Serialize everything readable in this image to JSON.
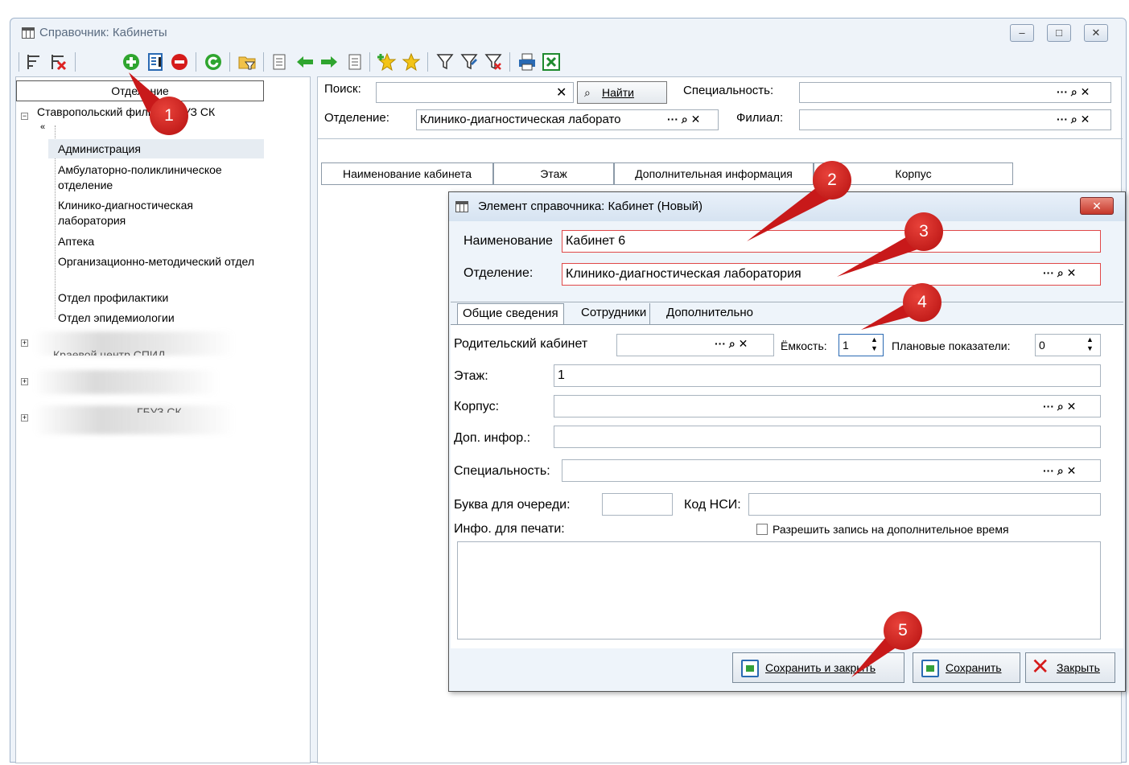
{
  "window": {
    "title": "Справочник: Кабинеты",
    "controls": [
      "‒",
      "□",
      "✕"
    ]
  },
  "left": {
    "header": "Отделение",
    "root": "Ставропольский филиал ГБУЗ СК",
    "root_sub": "«",
    "children": [
      "Администрация",
      "Амбулаторно-поликлиническое отделение",
      "Клинико-диагностическая лаборатория",
      "Аптека",
      "Организационно-методический отдел",
      "Отдел профилактики",
      "Отдел эпидемиологии"
    ],
    "blurred_1": "Краевой центр СПИД",
    "blurred_2": "ГБУЗ СК"
  },
  "filters": {
    "search_label": "Поиск:",
    "find_button": "Найти",
    "specialty_label": "Специальность:",
    "department_label": "Отделение:",
    "department_value": "Клинико-диагностическая лаборато",
    "branch_label": "Филиал:"
  },
  "table": {
    "columns": [
      "Наименование кабинета",
      "Этаж",
      "Дополнительная информация",
      "Корпус"
    ]
  },
  "dialog": {
    "title": "Элемент справочника: Кабинет (Новый)",
    "name_label": "Наименование",
    "name_value": "Кабинет 6",
    "dept_label": "Отделение:",
    "dept_value": "Клинико-диагностическая лаборатория",
    "tabs": [
      "Общие сведения",
      "Сотрудники",
      "Дополнительно"
    ],
    "parent_label": "Родительский кабинет",
    "capacity_label": "Ёмкость:",
    "capacity_value": "1",
    "plan_label": "Плановые показатели:",
    "plan_value": "0",
    "floor_label": "Этаж:",
    "floor_value": "1",
    "building_label": "Корпус:",
    "extra_label": "Доп. инфор.:",
    "specialty_label": "Специальность:",
    "queue_label": "Буква для очереди:",
    "nsi_label": "Код НСИ:",
    "print_label": "Инфо. для печати:",
    "extra_time_label": "Разрешить запись на дополнительное время",
    "buttons": {
      "save_close": "Сохранить и закрыть",
      "save": "Сохранить",
      "close": "Закрыть"
    }
  },
  "markers": [
    "1",
    "2",
    "3",
    "4",
    "5"
  ],
  "colors": {
    "marker": "#c8191a",
    "error_border": "#e04848",
    "accent": "#2a6ab3"
  }
}
